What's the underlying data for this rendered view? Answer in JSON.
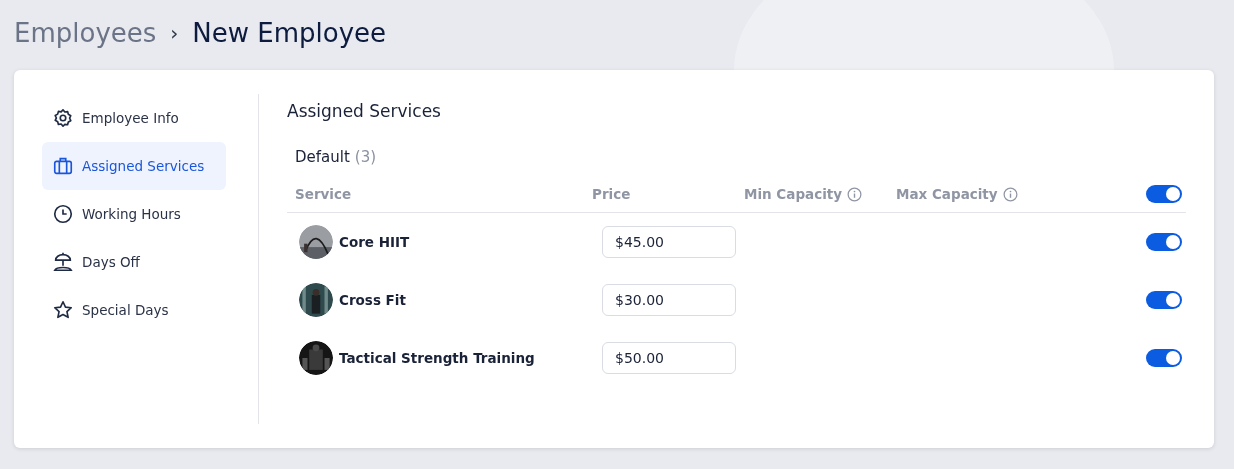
{
  "breadcrumb": {
    "parent": "Employees",
    "separator": "›",
    "current": "New Employee"
  },
  "sidebar": {
    "items": [
      {
        "label": "Employee Info",
        "selected": false
      },
      {
        "label": "Assigned Services",
        "selected": true
      },
      {
        "label": "Working Hours",
        "selected": false
      },
      {
        "label": "Days Off",
        "selected": false
      },
      {
        "label": "Special Days",
        "selected": false
      }
    ]
  },
  "panel": {
    "title": "Assigned Services",
    "group": {
      "name": "Default",
      "count": "(3)"
    },
    "columns": [
      {
        "label": "Service",
        "info": false
      },
      {
        "label": "Price",
        "info": false
      },
      {
        "label": "Min Capacity",
        "info": true
      },
      {
        "label": "Max Capacity",
        "info": true
      }
    ],
    "all_on": true,
    "rows": [
      {
        "name": "Core HIIT",
        "price": "$45.00",
        "on": true
      },
      {
        "name": "Cross Fit",
        "price": "$30.00",
        "on": true
      },
      {
        "name": "Tactical Strength Training",
        "price": "$50.00",
        "on": true
      }
    ]
  }
}
